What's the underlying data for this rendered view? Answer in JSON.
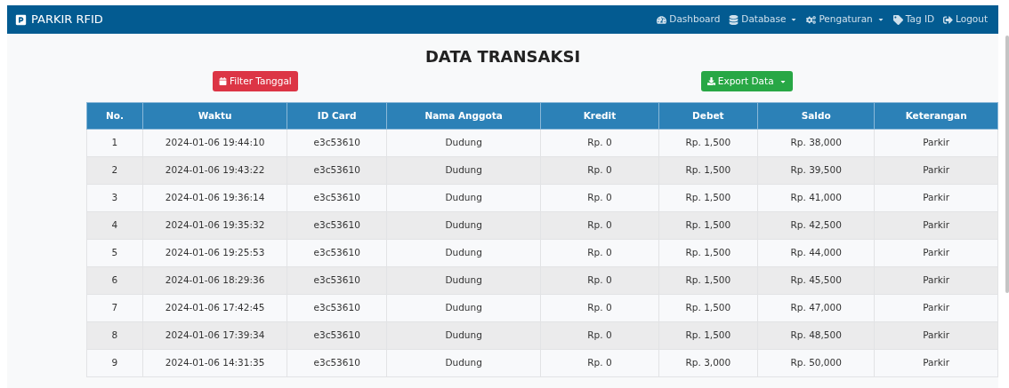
{
  "navbar": {
    "brand": "PARKIR RFID",
    "items": [
      {
        "kind": "link",
        "label": "Dashboard"
      },
      {
        "kind": "dropdown",
        "label": "Database"
      },
      {
        "kind": "dropdown",
        "label": "Pengaturan"
      },
      {
        "kind": "link",
        "label": "Tag ID"
      },
      {
        "kind": "link",
        "label": "Logout"
      }
    ]
  },
  "title": "DATA TRANSAKSI",
  "filter_button": "Filter Tanggal",
  "export_button": "Export Data",
  "table": {
    "columns": [
      "No.",
      "Waktu",
      "ID Card",
      "Nama Anggota",
      "Kredit",
      "Debet",
      "Saldo",
      "Keterangan"
    ],
    "rows": [
      [
        "1",
        "2024-01-06 19:44:10",
        "e3c53610",
        "Dudung",
        "Rp. 0",
        "Rp. 1,500",
        "Rp. 38,000",
        "Parkir"
      ],
      [
        "2",
        "2024-01-06 19:43:22",
        "e3c53610",
        "Dudung",
        "Rp. 0",
        "Rp. 1,500",
        "Rp. 39,500",
        "Parkir"
      ],
      [
        "3",
        "2024-01-06 19:36:14",
        "e3c53610",
        "Dudung",
        "Rp. 0",
        "Rp. 1,500",
        "Rp. 41,000",
        "Parkir"
      ],
      [
        "4",
        "2024-01-06 19:35:32",
        "e3c53610",
        "Dudung",
        "Rp. 0",
        "Rp. 1,500",
        "Rp. 42,500",
        "Parkir"
      ],
      [
        "5",
        "2024-01-06 19:25:53",
        "e3c53610",
        "Dudung",
        "Rp. 0",
        "Rp. 1,500",
        "Rp. 44,000",
        "Parkir"
      ],
      [
        "6",
        "2024-01-06 18:29:36",
        "e3c53610",
        "Dudung",
        "Rp. 0",
        "Rp. 1,500",
        "Rp. 45,500",
        "Parkir"
      ],
      [
        "7",
        "2024-01-06 17:42:45",
        "e3c53610",
        "Dudung",
        "Rp. 0",
        "Rp. 1,500",
        "Rp. 47,000",
        "Parkir"
      ],
      [
        "8",
        "2024-01-06 17:39:34",
        "e3c53610",
        "Dudung",
        "Rp. 0",
        "Rp. 1,500",
        "Rp. 48,500",
        "Parkir"
      ],
      [
        "9",
        "2024-01-06 14:31:35",
        "e3c53610",
        "Dudung",
        "Rp. 0",
        "Rp. 3,000",
        "Rp. 50,000",
        "Parkir"
      ]
    ]
  }
}
